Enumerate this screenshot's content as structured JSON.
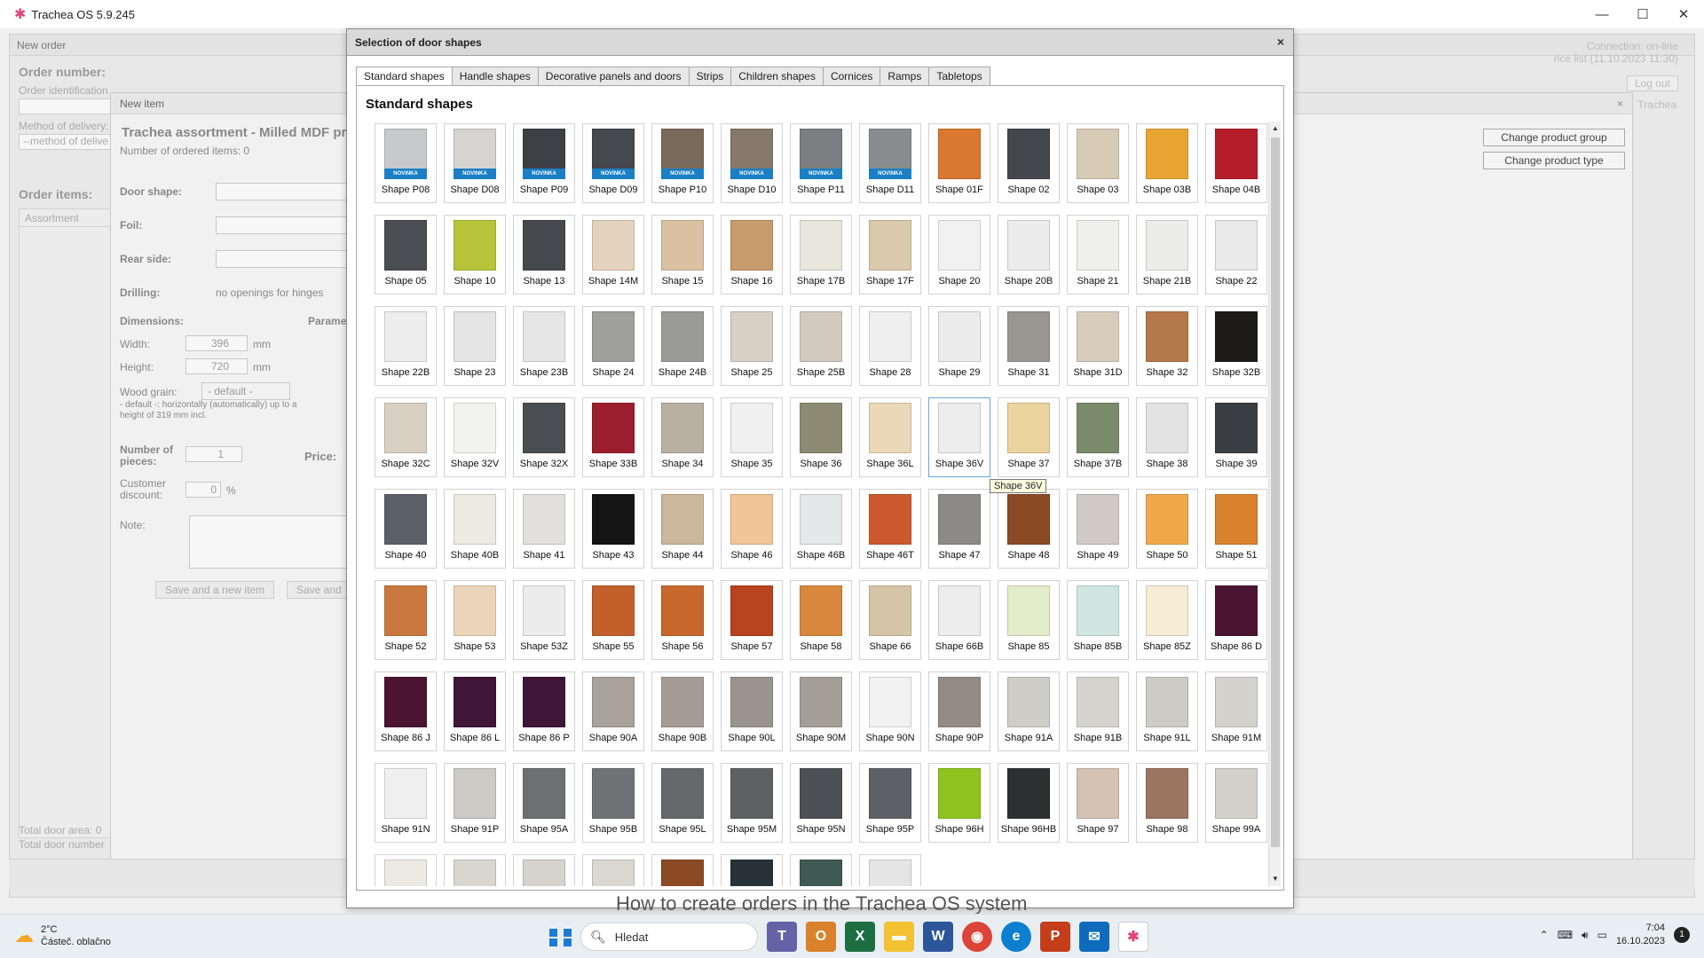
{
  "window": {
    "title": "Trachea OS 5.9.245",
    "minimize": "—",
    "maximize": "☐",
    "close": "✕"
  },
  "order": {
    "header": "New order",
    "close": "×",
    "order_number_label": "Order number:",
    "order_identification_label": "Order identification",
    "method_of_delivery_label": "Method of delivery:",
    "method_of_delivery_value": "--method of delive",
    "order_items_label": "Order items:",
    "assortment_header": "Assortment",
    "total_door_area": "Total door area:  0",
    "total_door_number": "Total door number",
    "connection": "Connection:  on-line",
    "price_list": "rice list (11.10.2023 11:30)",
    "logout": "Log out",
    "trachea": "Trachea"
  },
  "new_item": {
    "header": "New item",
    "close": "×",
    "title": "Trachea assortment - Milled MDF pr",
    "ordered_count": "Number of ordered items:  0",
    "door_shape": "Door shape:",
    "foil": "Foil:",
    "rear_side": "Rear side:",
    "drilling": "Drilling:",
    "drilling_value": "no openings for hinges",
    "dimensions": "Dimensions:",
    "parameters": "Parame",
    "width_label": "Width:",
    "width_value": "396",
    "height_label": "Height:",
    "height_value": "720",
    "unit": "mm",
    "wood_grain": "Wood grain:",
    "wood_grain_value": "- default -",
    "grain_note": "- default -: horizontally (automatically) up to a height of 319 mm incl.",
    "pieces_label": "Number of pieces:",
    "pieces_value": "1",
    "price_label": "Price:",
    "discount_label": "Customer discount:",
    "discount_value": "0",
    "percent": "%",
    "note_label": "Note:",
    "save_new": "Save and a new item",
    "save_and": "Save and",
    "change_group": "Change product group",
    "change_type": "Change product type"
  },
  "modal": {
    "title": "Selection of door shapes",
    "close": "×",
    "tabs": [
      "Standard shapes",
      "Handle shapes",
      "Decorative panels and doors",
      "Strips",
      "Children shapes",
      "Cornices",
      "Ramps",
      "Tabletops"
    ],
    "active_tab": 0,
    "section_title": "Standard shapes",
    "tooltip": "Shape 36V",
    "novinka": "NOVINKA",
    "shapes": [
      {
        "label": "Shape P08",
        "color": "#c8c9cb",
        "novinka": true
      },
      {
        "label": "Shape D08",
        "color": "#d6d4d0",
        "novinka": true
      },
      {
        "label": "Shape P09",
        "color": "#3d4045",
        "novinka": true
      },
      {
        "label": "Shape D09",
        "color": "#45484d",
        "novinka": true
      },
      {
        "label": "Shape P10",
        "color": "#7a6a5c",
        "novinka": true
      },
      {
        "label": "Shape D10",
        "color": "#86786a",
        "novinka": true
      },
      {
        "label": "Shape P11",
        "color": "#7c7e82",
        "novinka": true
      },
      {
        "label": "Shape D11",
        "color": "#8a8c90",
        "novinka": true
      },
      {
        "label": "Shape 01F",
        "color": "#d9782e"
      },
      {
        "label": "Shape 02",
        "color": "#44484d"
      },
      {
        "label": "Shape 03",
        "color": "#d8cbb5"
      },
      {
        "label": "Shape 03B",
        "color": "#e8a534"
      },
      {
        "label": "Shape 04B",
        "color": "#b51d2a"
      },
      {
        "label": "Shape 05",
        "color": "#4a4d52"
      },
      {
        "label": "Shape 10",
        "color": "#b7c43a"
      },
      {
        "label": "Shape 13",
        "color": "#45484d"
      },
      {
        "label": "Shape 14M",
        "color": "#e4d3bc"
      },
      {
        "label": "Shape 15",
        "color": "#d9c1a1"
      },
      {
        "label": "Shape 16",
        "color": "#c89b6c"
      },
      {
        "label": "Shape 17B",
        "color": "#e9e6dc"
      },
      {
        "label": "Shape 17F",
        "color": "#dac9ab"
      },
      {
        "label": "Shape 20",
        "color": "#f1f1f1"
      },
      {
        "label": "Shape 20B",
        "color": "#ececec"
      },
      {
        "label": "Shape 21",
        "color": "#efefed"
      },
      {
        "label": "Shape 21B",
        "color": "#ececea"
      },
      {
        "label": "Shape 22",
        "color": "#e9e9e9"
      },
      {
        "label": "Shape 22B",
        "color": "#ededed"
      },
      {
        "label": "Shape 23",
        "color": "#e4e4e4"
      },
      {
        "label": "Shape 23B",
        "color": "#e6e6e6"
      },
      {
        "label": "Shape 24",
        "color": "#9fa09e"
      },
      {
        "label": "Shape 24B",
        "color": "#9a9b99"
      },
      {
        "label": "Shape 25",
        "color": "#d9cfc5"
      },
      {
        "label": "Shape 25B",
        "color": "#d3c9bf"
      },
      {
        "label": "Shape 28",
        "color": "#efefef"
      },
      {
        "label": "Shape 29",
        "color": "#ececec"
      },
      {
        "label": "Shape 31",
        "color": "#999591"
      },
      {
        "label": "Shape 31D",
        "color": "#d8ccbd"
      },
      {
        "label": "Shape 32",
        "color": "#b57849"
      },
      {
        "label": "Shape 32B",
        "color": "#1e1b1b"
      },
      {
        "label": "Shape 32C",
        "color": "#d9d0c3"
      },
      {
        "label": "Shape 32V",
        "color": "#f2f2f1"
      },
      {
        "label": "Shape 32X",
        "color": "#4a4d52"
      },
      {
        "label": "Shape 33B",
        "color": "#9c1e2d"
      },
      {
        "label": "Shape 34",
        "color": "#b8b0a0"
      },
      {
        "label": "Shape 35",
        "color": "#f0f0f0"
      },
      {
        "label": "Shape 36",
        "color": "#8d8a74"
      },
      {
        "label": "Shape 36L",
        "color": "#ead8b9"
      },
      {
        "label": "Shape 36V",
        "color": "#ededed",
        "hover": true
      },
      {
        "label": "Shape 37",
        "color": "#ecd49e"
      },
      {
        "label": "Shape 37B",
        "color": "#7b8a6b"
      },
      {
        "label": "Shape 38",
        "color": "#e3e3e3"
      },
      {
        "label": "Shape 39",
        "color": "#3b3f45"
      },
      {
        "label": "Shape 40",
        "color": "#5b6068"
      },
      {
        "label": "Shape 40B",
        "color": "#ecebe0"
      },
      {
        "label": "Shape 41",
        "color": "#e1e0dc"
      },
      {
        "label": "Shape 43",
        "color": "#151515"
      },
      {
        "label": "Shape 44",
        "color": "#cbb79a"
      },
      {
        "label": "Shape 46",
        "color": "#f1c597"
      },
      {
        "label": "Shape 46B",
        "color": "#e4e8e8"
      },
      {
        "label": "Shape 46T",
        "color": "#cd5a2e"
      },
      {
        "label": "Shape 47",
        "color": "#8b8a86"
      },
      {
        "label": "Shape 48",
        "color": "#8a4a26"
      },
      {
        "label": "Shape 49",
        "color": "#cfcac5"
      },
      {
        "label": "Shape 50",
        "color": "#efa94a"
      },
      {
        "label": "Shape 51",
        "color": "#d9822e"
      },
      {
        "label": "Shape 52",
        "color": "#c9793f"
      },
      {
        "label": "Shape 53",
        "color": "#ecd4b9"
      },
      {
        "label": "Shape 53Z",
        "color": "#ececec"
      },
      {
        "label": "Shape 55",
        "color": "#c35f2b"
      },
      {
        "label": "Shape 56",
        "color": "#c8672c"
      },
      {
        "label": "Shape 57",
        "color": "#b9431f"
      },
      {
        "label": "Shape 58",
        "color": "#d9873d"
      },
      {
        "label": "Shape 66",
        "color": "#d6c4a6"
      },
      {
        "label": "Shape 66B",
        "color": "#ededed"
      },
      {
        "label": "Shape 85",
        "color": "#e3edc9"
      },
      {
        "label": "Shape 85B",
        "color": "#cfe7e0"
      },
      {
        "label": "Shape 85Z",
        "color": "#f7ecd4"
      },
      {
        "label": "Shape 86 D",
        "color": "#4b1433"
      },
      {
        "label": "Shape 86 J",
        "color": "#4b1433"
      },
      {
        "label": "Shape 86 L",
        "color": "#3f1538"
      },
      {
        "label": "Shape 86 P",
        "color": "#3f1538"
      },
      {
        "label": "Shape 90A",
        "color": "#a9a29b"
      },
      {
        "label": "Shape 90B",
        "color": "#a59d95"
      },
      {
        "label": "Shape 90L",
        "color": "#9a948e"
      },
      {
        "label": "Shape 90M",
        "color": "#a49e97"
      },
      {
        "label": "Shape 90N",
        "color": "#f2f2f2"
      },
      {
        "label": "Shape 90P",
        "color": "#938b84"
      },
      {
        "label": "Shape 91A",
        "color": "#cfcdc7"
      },
      {
        "label": "Shape 91B",
        "color": "#d5d3cd"
      },
      {
        "label": "Shape 91L",
        "color": "#cdcbc6"
      },
      {
        "label": "Shape 91M",
        "color": "#d4d2cd"
      },
      {
        "label": "Shape 91N",
        "color": "#f0f0f0"
      },
      {
        "label": "Shape 91P",
        "color": "#cbcac5"
      },
      {
        "label": "Shape 95A",
        "color": "#6d6f72"
      },
      {
        "label": "Shape 95B",
        "color": "#707275"
      },
      {
        "label": "Shape 95L",
        "color": "#66686b"
      },
      {
        "label": "Shape 95M",
        "color": "#5e6063"
      },
      {
        "label": "Shape 95N",
        "color": "#4d5156"
      },
      {
        "label": "Shape 95P",
        "color": "#5d6064"
      },
      {
        "label": "Shape 96H",
        "color": "#8fc41f"
      },
      {
        "label": "Shape 96HB",
        "color": "#2e2f31"
      },
      {
        "label": "Shape 97",
        "color": "#d6c2b3"
      },
      {
        "label": "Shape 98",
        "color": "#9c7561"
      },
      {
        "label": "Shape 99A",
        "color": "#d2d0c9"
      },
      {
        "label": "",
        "color": "#eceae2"
      },
      {
        "label": "",
        "color": "#d8d6cf"
      },
      {
        "label": "",
        "color": "#d5d3cc"
      },
      {
        "label": "",
        "color": "#d9d7d0"
      },
      {
        "label": "",
        "color": "#8b4a24"
      },
      {
        "label": "",
        "color": "#263238"
      },
      {
        "label": "",
        "color": "#3f5a52"
      },
      {
        "label": "",
        "color": "#e5e5e5"
      }
    ]
  },
  "overlay_caption": "How to create orders in the Trachea OS system",
  "taskbar": {
    "temperature": "2°C",
    "weather": "Částeč. oblačno",
    "search": "Hledat",
    "time": "7:04",
    "date": "16.10.2023",
    "notifications": "1"
  }
}
